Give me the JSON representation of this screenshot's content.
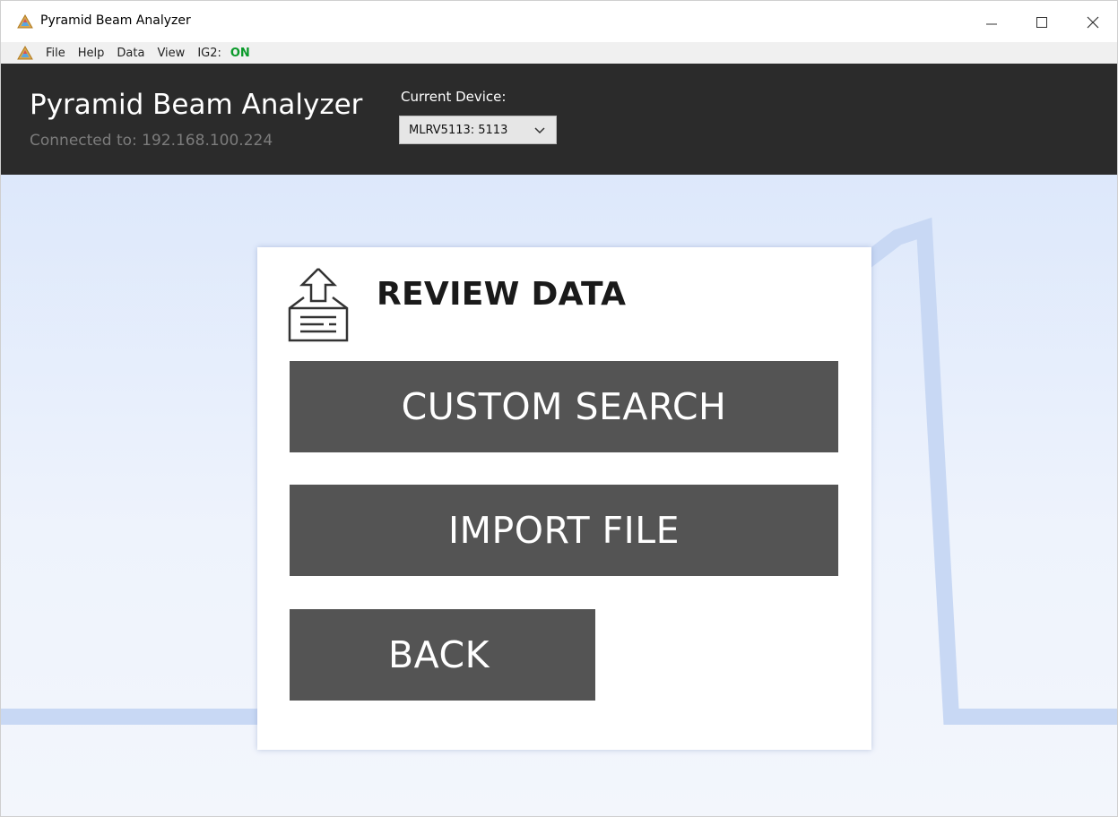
{
  "window": {
    "title": "Pyramid Beam Analyzer",
    "controls": {
      "minimize": "—",
      "maximize": "☐",
      "close": "✕"
    }
  },
  "menu": {
    "items": [
      "File",
      "Help",
      "Data",
      "View",
      "IG2:"
    ],
    "ig2_status": "ON",
    "ig2_status_color": "#0a9a2a"
  },
  "header": {
    "app_title": "Pyramid Beam Analyzer",
    "connection": "Connected to: 192.168.100.224",
    "device_label": "Current Device:",
    "device_value": "MLRV5113: 5113"
  },
  "card": {
    "title": "REVIEW DATA",
    "icon": "upload-document-icon",
    "buttons": {
      "custom_search": "CUSTOM SEARCH",
      "import_file": "IMPORT FILE",
      "back": "BACK"
    }
  },
  "colors": {
    "header_bg": "#2b2b2b",
    "button_bg": "#545454",
    "content_bg": "#e6eefc",
    "ig2_on": "#0a9a2a"
  }
}
